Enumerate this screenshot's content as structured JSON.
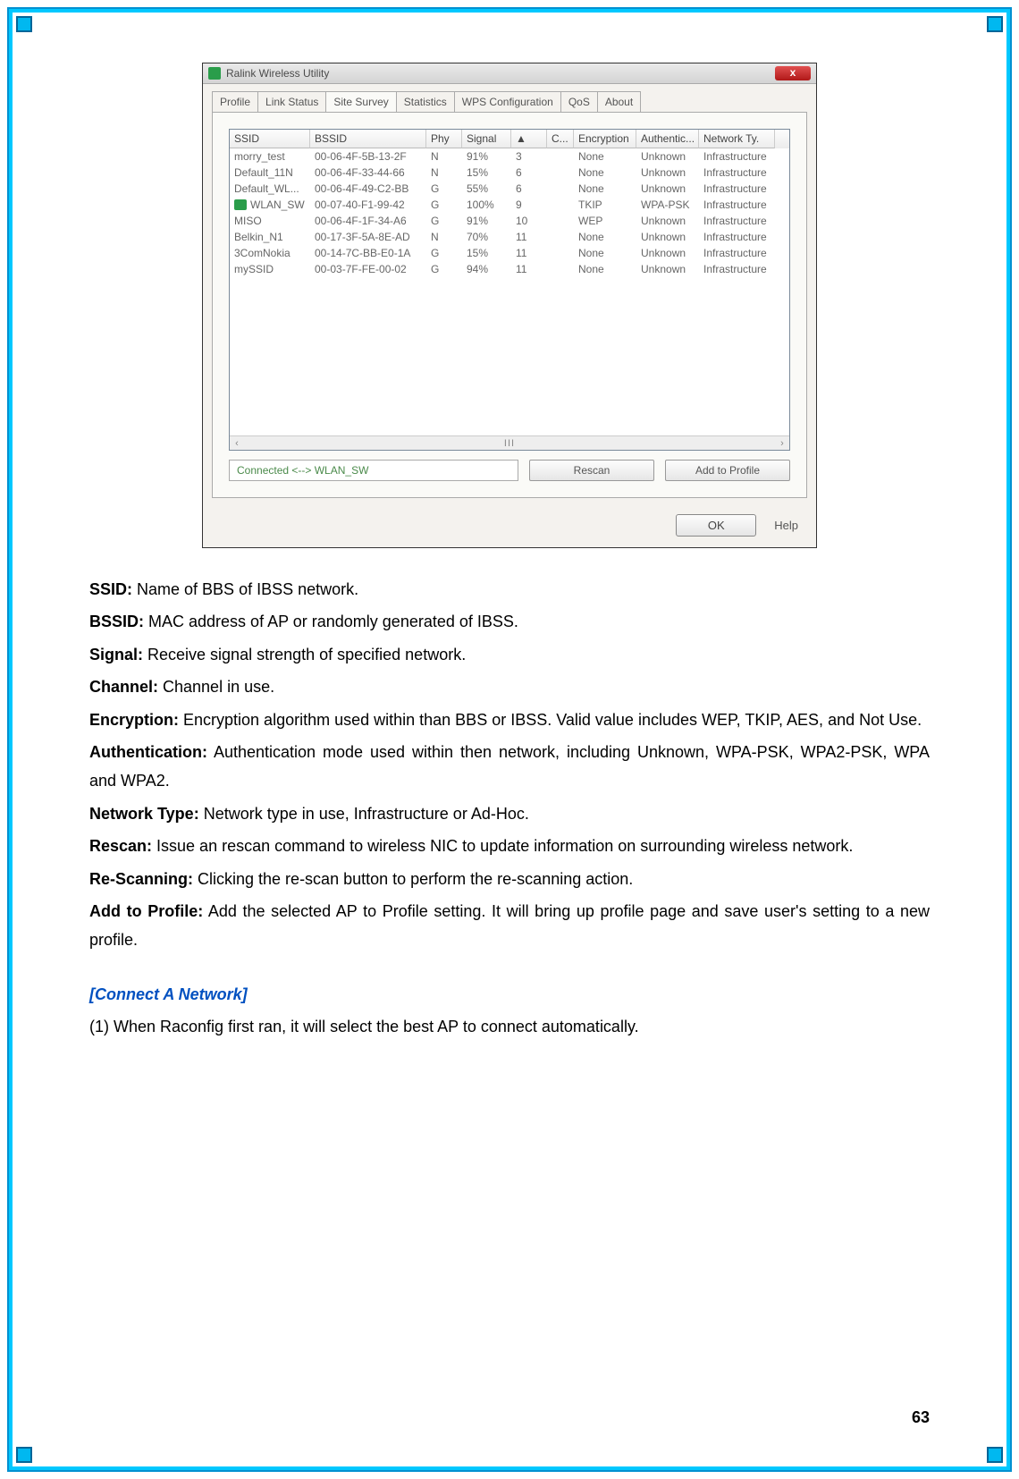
{
  "app": {
    "title": "Ralink Wireless Utility",
    "close_glyph": "x",
    "tabs": [
      "Profile",
      "Link Status",
      "Site Survey",
      "Statistics",
      "WPS Configuration",
      "QoS",
      "About"
    ],
    "active_tab_index": 2,
    "columns": [
      "SSID",
      "BSSID",
      "Phy",
      "Signal",
      "▲",
      "C...",
      "Encryption",
      "Authentic...",
      "Network Ty."
    ],
    "rows": [
      {
        "ssid": "morry_test",
        "bssid": "00-06-4F-5B-13-2F",
        "phy": "N",
        "signal": "91%",
        "a": "3",
        "c": "",
        "enc": "None",
        "auth": "Unknown",
        "ntype": "Infrastructure",
        "connected": false
      },
      {
        "ssid": "Default_11N",
        "bssid": "00-06-4F-33-44-66",
        "phy": "N",
        "signal": "15%",
        "a": "6",
        "c": "",
        "enc": "None",
        "auth": "Unknown",
        "ntype": "Infrastructure",
        "connected": false
      },
      {
        "ssid": "Default_WL...",
        "bssid": "00-06-4F-49-C2-BB",
        "phy": "G",
        "signal": "55%",
        "a": "6",
        "c": "",
        "enc": "None",
        "auth": "Unknown",
        "ntype": "Infrastructure",
        "connected": false
      },
      {
        "ssid": "WLAN_SW",
        "bssid": "00-07-40-F1-99-42",
        "phy": "G",
        "signal": "100%",
        "a": "9",
        "c": "",
        "enc": "TKIP",
        "auth": "WPA-PSK",
        "ntype": "Infrastructure",
        "connected": true
      },
      {
        "ssid": "MISO",
        "bssid": "00-06-4F-1F-34-A6",
        "phy": "G",
        "signal": "91%",
        "a": "10",
        "c": "",
        "enc": "WEP",
        "auth": "Unknown",
        "ntype": "Infrastructure",
        "connected": false
      },
      {
        "ssid": "Belkin_N1",
        "bssid": "00-17-3F-5A-8E-AD",
        "phy": "N",
        "signal": "70%",
        "a": "11",
        "c": "",
        "enc": "None",
        "auth": "Unknown",
        "ntype": "Infrastructure",
        "connected": false
      },
      {
        "ssid": "3ComNokia",
        "bssid": "00-14-7C-BB-E0-1A",
        "phy": "G",
        "signal": "15%",
        "a": "11",
        "c": "",
        "enc": "None",
        "auth": "Unknown",
        "ntype": "Infrastructure",
        "connected": false
      },
      {
        "ssid": "mySSID",
        "bssid": "00-03-7F-FE-00-02",
        "phy": "G",
        "signal": "94%",
        "a": "11",
        "c": "",
        "enc": "None",
        "auth": "Unknown",
        "ntype": "Infrastructure",
        "connected": false
      }
    ],
    "status_text": "Connected <--> WLAN_SW",
    "rescan_label": "Rescan",
    "add_profile_label": "Add to Profile",
    "ok_label": "OK",
    "help_label": "Help",
    "scroll_marks": "III"
  },
  "defs": {
    "ssid": {
      "t": "SSID:",
      "d": " Name of BBS of IBSS network."
    },
    "bssid": {
      "t": "BSSID:",
      "d": " MAC address of AP or randomly generated of IBSS."
    },
    "signal": {
      "t": "Signal:",
      "d": " Receive signal strength of specified network."
    },
    "channel": {
      "t": "Channel:",
      "d": " Channel in use."
    },
    "encryption": {
      "t": "Encryption:",
      "d": " Encryption algorithm used within than BBS or IBSS. Valid value includes WEP, TKIP, AES, and Not Use."
    },
    "auth": {
      "t": "Authentication:",
      "d": " Authentication mode used within then network, including Unknown, WPA-PSK, WPA2-PSK, WPA and WPA2."
    },
    "ntype": {
      "t": "Network Type:",
      "d": " Network type in use, Infrastructure or Ad-Hoc."
    },
    "rescan": {
      "t": "Rescan:",
      "d": " Issue an rescan command to wireless NIC to update information on surrounding wireless network."
    },
    "rescanning": {
      "t": "Re-Scanning:",
      "d": " Clicking the re-scan button to perform the re-scanning action."
    },
    "addprofile": {
      "t": "Add to Profile:",
      "d": " Add the selected AP to Profile setting. It will bring up profile page and save user's setting to a new profile."
    }
  },
  "connect": {
    "heading": "[Connect A Network]",
    "line1": "(1) When Raconfig first ran, it will select the best AP to connect automatically."
  },
  "page_number": "63"
}
